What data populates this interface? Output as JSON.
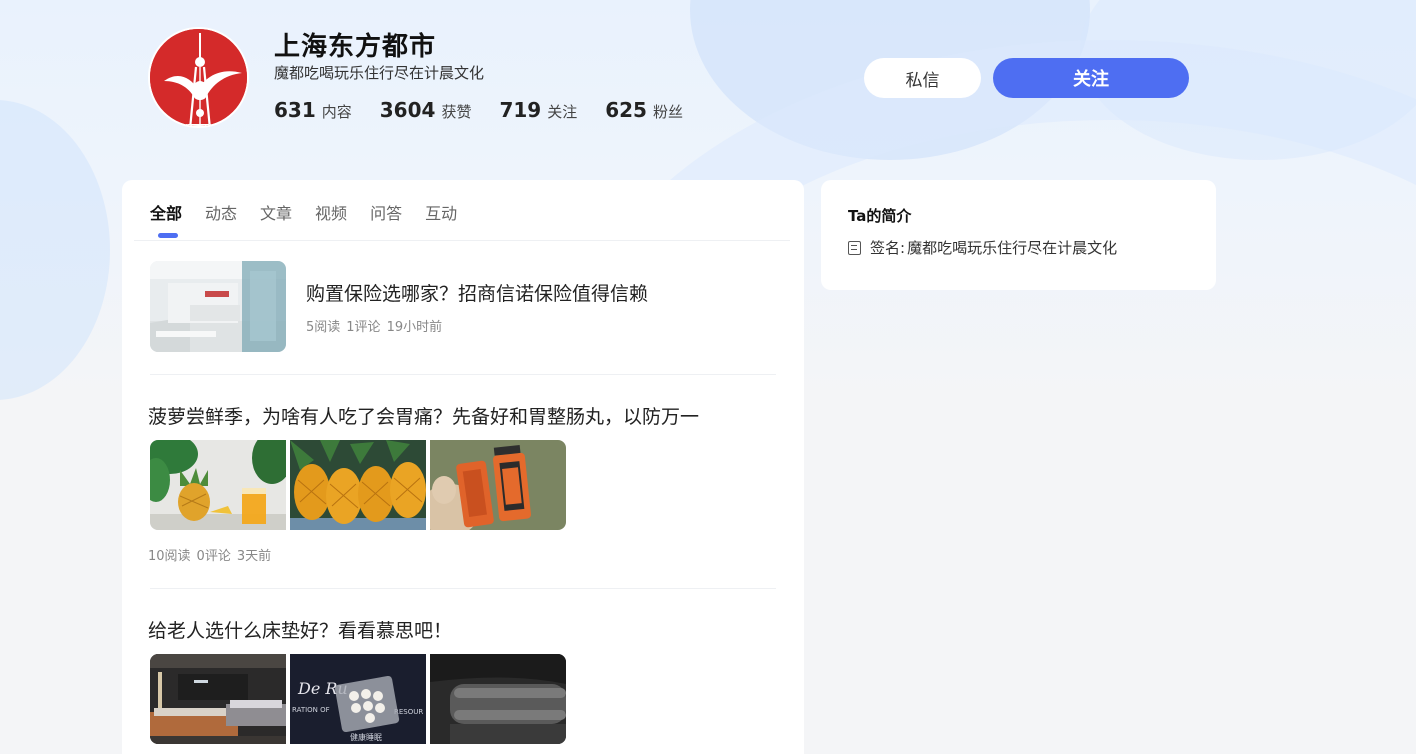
{
  "profile": {
    "name": "上海东方都市",
    "signature": "魔都吃喝玩乐住行尽在计晨文化",
    "stats": [
      {
        "num": "631",
        "label": "内容"
      },
      {
        "num": "3604",
        "label": "获赞"
      },
      {
        "num": "719",
        "label": "关注"
      },
      {
        "num": "625",
        "label": "粉丝"
      }
    ],
    "message_button": "私信",
    "follow_button": "关注"
  },
  "tabs": [
    "全部",
    "动态",
    "文章",
    "视频",
    "问答",
    "互动"
  ],
  "active_tab": "全部",
  "posts": [
    {
      "title": "购置保险选哪家？招商信诺保险值得信赖",
      "meta": [
        "5阅读",
        "1评论",
        "19小时前"
      ]
    },
    {
      "title": "菠萝尝鲜季，为啥有人吃了会胃痛？先备好和胃整肠丸，以防万一",
      "meta": [
        "10阅读",
        "0评论",
        "3天前"
      ]
    },
    {
      "title": "给老人选什么床垫好？看看慕思吧！"
    }
  ],
  "intro": {
    "title": "Ta的简介",
    "signature_label": "签名:",
    "signature_value": "魔都吃喝玩乐住行尽在计晨文化"
  },
  "image_text": {
    "mattress_brand": "De Ru",
    "mattress_line": "RATION OF",
    "mattress_line2": "RESOUR",
    "mattress_cn": "健康睡眠"
  },
  "colors": {
    "accent": "#4e6ef2",
    "avatar_red": "#d42a2a"
  }
}
